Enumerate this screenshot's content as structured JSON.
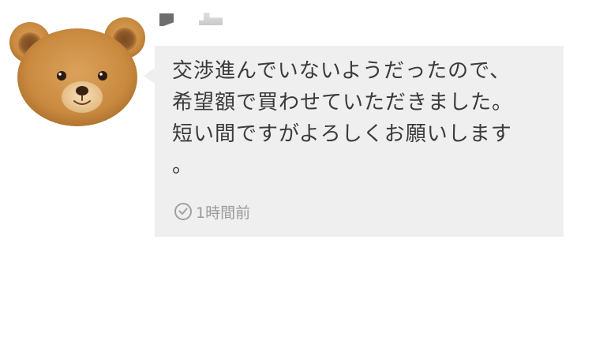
{
  "sender": {
    "avatar_icon": "teddy-bear-avatar-icon"
  },
  "message": {
    "lines": [
      "交渉進んでいないようだったので、",
      "希望額で買わせていただきました。",
      "短い間ですがよろしくお願いします",
      "。"
    ],
    "timestamp": "1時間前",
    "clock_icon": "clock-icon"
  },
  "colors": {
    "bubble_background": "#efefef",
    "message_text": "#3a3a3a",
    "timestamp_text": "#9a9a9a"
  }
}
